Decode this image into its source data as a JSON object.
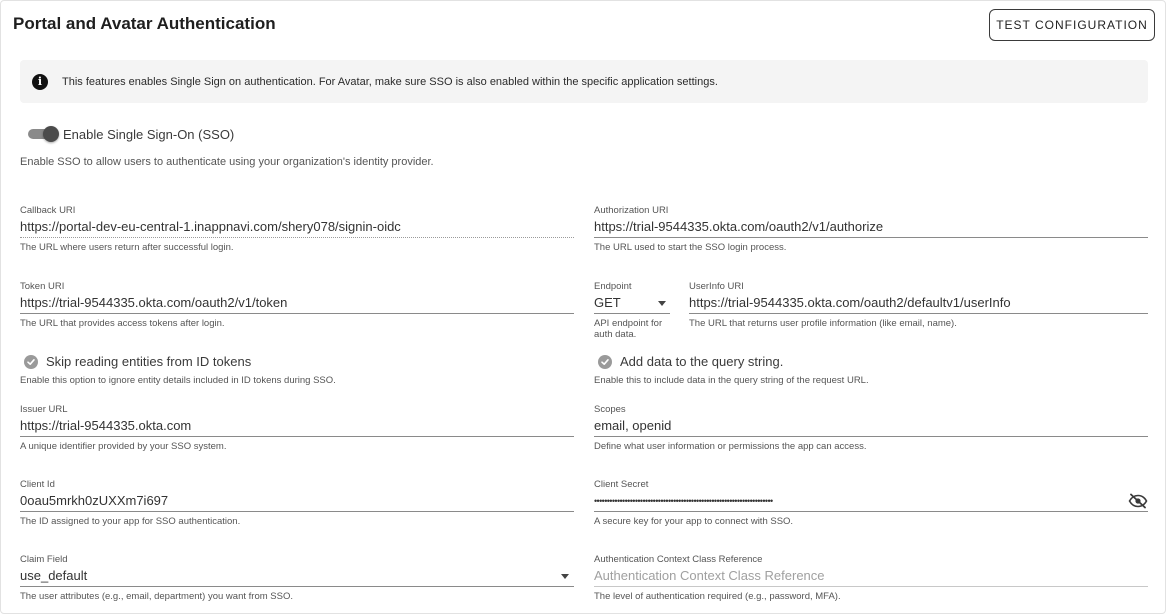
{
  "header": {
    "title": "Portal and Avatar Authentication",
    "test_button_label": "TEST CONFIGURATION"
  },
  "info": {
    "icon": "info-icon",
    "text": "This features enables Single Sign on authentication. For Avatar, make sure SSO is also enabled within the specific application settings."
  },
  "sso": {
    "toggle_label": "Enable Single Sign-On (SSO)",
    "enabled": true,
    "description": "Enable SSO to allow users to authenticate using your organization's identity provider."
  },
  "fields": {
    "callback_uri": {
      "label": "Callback URI",
      "value": "https://portal-dev-eu-central-1.inappnavi.com/shery078/signin-oidc",
      "help": "The URL where users return after successful login."
    },
    "authorization_uri": {
      "label": "Authorization URI",
      "value": "https://trial-9544335.okta.com/oauth2/v1/authorize",
      "help": "The URL used to start the SSO login process."
    },
    "token_uri": {
      "label": "Token URI",
      "value": "https://trial-9544335.okta.com/oauth2/v1/token",
      "help": "The URL that provides access tokens after login."
    },
    "endpoint": {
      "label": "Endpoint",
      "value": "GET",
      "help_line1": "API endpoint for",
      "help_line2": "auth data."
    },
    "userinfo_uri": {
      "label": "UserInfo URI",
      "value": "https://trial-9544335.okta.com/oauth2/defaultv1/userInfo",
      "help": "The URL that returns user profile information (like email, name)."
    },
    "issuer_url": {
      "label": "Issuer URL",
      "value": "https://trial-9544335.okta.com",
      "help": "A unique identifier provided by your SSO system."
    },
    "scopes": {
      "label": "Scopes",
      "value": "email, openid",
      "help": "Define what user information or permissions the app can access."
    },
    "client_id": {
      "label": "Client Id",
      "value": "0oau5mrkh0zUXXm7i697",
      "help": "The ID assigned to your app for SSO authentication."
    },
    "client_secret": {
      "label": "Client Secret",
      "value": "••••••••••••••••••••••••••••••••••••••••••••••••••••••••••••••••••••••",
      "help": "A secure key for your app to connect with SSO.",
      "toggle_icon": "eye-off-icon"
    },
    "claim_field": {
      "label": "Claim Field",
      "value": "use_default",
      "help": "The user attributes (e.g., email, department) you want from SSO."
    },
    "acr": {
      "label": "Authentication Context Class Reference",
      "placeholder": "Authentication Context Class Reference",
      "help": "The level of authentication required (e.g., password, MFA)."
    }
  },
  "options": {
    "skip_id_tokens": {
      "label": "Skip reading entities from ID tokens",
      "help": "Enable this option to ignore entity details included in ID tokens during SSO.",
      "checked": true
    },
    "add_query_string": {
      "label": "Add data to the query string.",
      "help": "Enable this to include data in the query string of the request URL.",
      "checked": true
    }
  }
}
